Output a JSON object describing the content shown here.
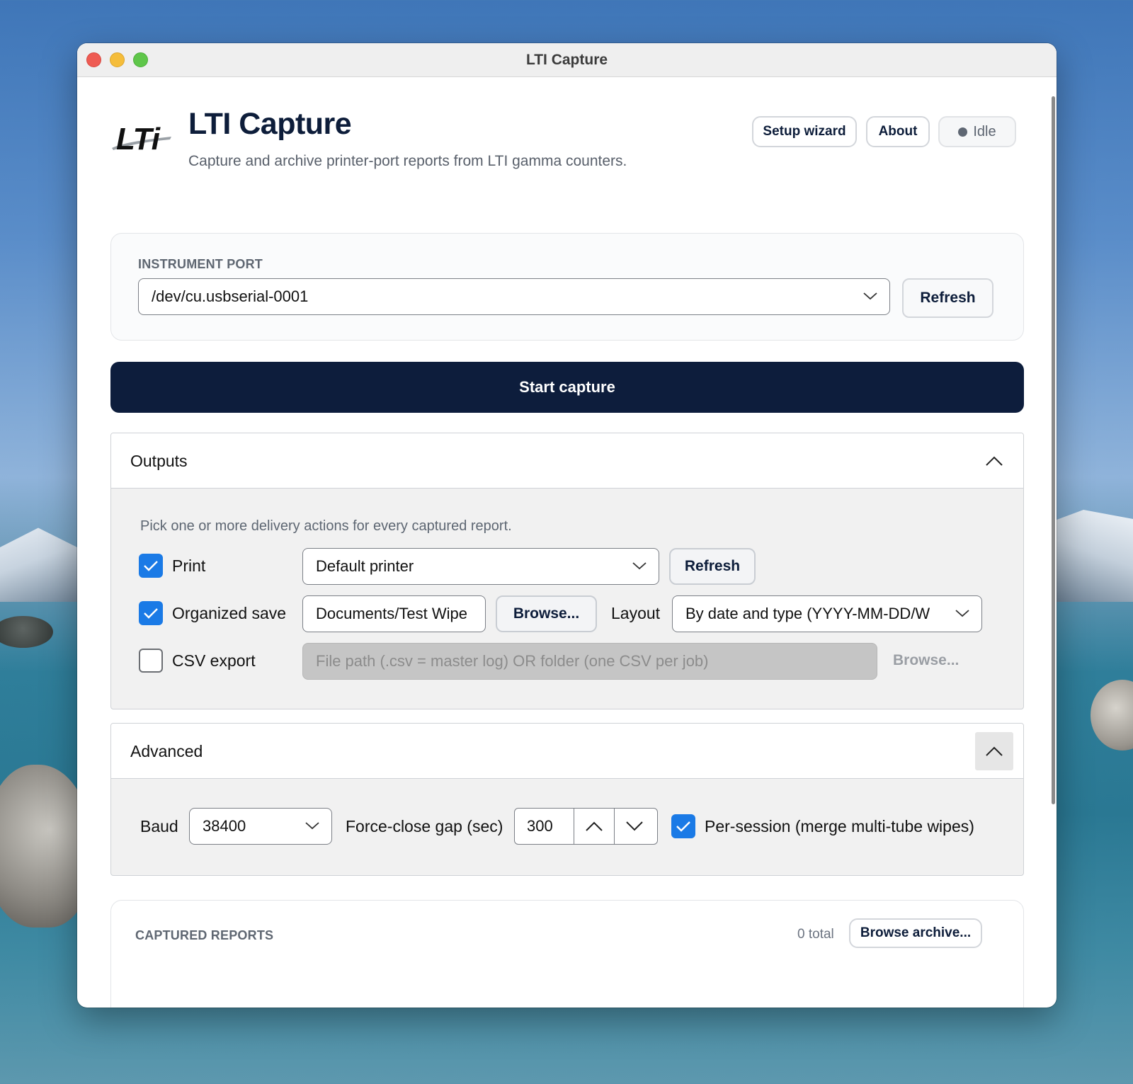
{
  "window": {
    "title": "LTI Capture"
  },
  "header": {
    "logo_text": "LTi",
    "title": "LTI Capture",
    "subtitle": "Capture and archive printer-port reports from LTI gamma counters.",
    "setup_wizard_label": "Setup wizard",
    "about_label": "About",
    "status_label": "Idle"
  },
  "instrument_port": {
    "label": "INSTRUMENT PORT",
    "selected_port": "/dev/cu.usbserial-0001",
    "refresh_label": "Refresh"
  },
  "start_capture_label": "Start capture",
  "outputs": {
    "title": "Outputs",
    "expanded": true,
    "hint": "Pick one or more delivery actions for every captured report.",
    "print": {
      "label": "Print",
      "checked": true,
      "printer": "Default printer",
      "refresh_label": "Refresh"
    },
    "organized_save": {
      "label": "Organized save",
      "checked": true,
      "folder": "Documents/Test Wipe",
      "browse_label": "Browse...",
      "layout_label": "Layout",
      "layout_value": "By date and type (YYYY-MM-DD/W"
    },
    "csv_export": {
      "label": "CSV export",
      "checked": false,
      "placeholder": "File path (.csv = master log) OR folder (one CSV per job)",
      "browse_label": "Browse..."
    }
  },
  "advanced": {
    "title": "Advanced",
    "expanded": true,
    "baud_label": "Baud",
    "baud_value": "38400",
    "force_close_label": "Force-close gap (sec)",
    "force_close_value": "300",
    "per_session": {
      "label": "Per-session (merge multi-tube wipes)",
      "checked": true
    }
  },
  "captured_reports": {
    "label": "CAPTURED REPORTS",
    "count": "0 total",
    "browse_archive_label": "Browse archive..."
  },
  "colors": {
    "primary_navy": "#0d1d3c",
    "checkbox_blue": "#1a7ae6",
    "close_red": "#ee5b53",
    "minimize_yellow": "#f5bd3a",
    "maximize_green": "#5fc64a"
  },
  "icons": {
    "dropdown": "chevron-down-icon",
    "collapse": "chevron-up-icon",
    "check": "checkmark-icon",
    "status": "status-dot-icon"
  }
}
